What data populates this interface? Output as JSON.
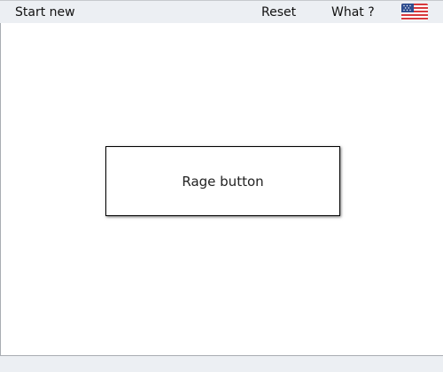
{
  "menu": {
    "start_new": "Start new",
    "reset": "Reset",
    "what": "What ?",
    "language_icon": "us-flag-icon"
  },
  "main": {
    "button_label": "Rage button"
  },
  "colors": {
    "menubar_bg": "#eceff3",
    "content_bg": "#ffffff",
    "flag_red": "#d8393c",
    "flag_blue": "#2e4d8f"
  }
}
